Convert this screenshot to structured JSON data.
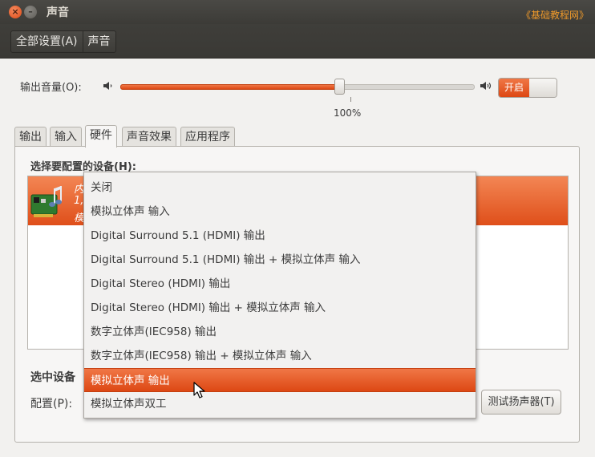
{
  "window": {
    "title": "声音",
    "close_icon": "×",
    "minimize_icon": "–",
    "watermark": "《基础教程网》"
  },
  "toolbar": {
    "all_settings": "全部设置(A)",
    "current": "声音"
  },
  "volume": {
    "label": "输出音量(O):",
    "value_percent": 62,
    "mark_label": "100%",
    "toggle_label": "开启",
    "toggle_on": true
  },
  "tabs": [
    {
      "label": "输出",
      "active": false
    },
    {
      "label": "输入",
      "active": false
    },
    {
      "label": "硬件",
      "active": true
    },
    {
      "label": "声音效果",
      "active": false
    },
    {
      "label": "应用程序",
      "active": false
    }
  ],
  "hardware": {
    "select_label": "选择要配置的设备(H):",
    "device_row_line1": "内",
    "device_row_line2": "1,",
    "device_row_line3": "模",
    "selected_device_label": "选中设备",
    "profile_label": "配置(P):",
    "test_button": "测试扬声器(T)"
  },
  "menu": {
    "items": [
      {
        "label": "关闭"
      },
      {
        "label": "模拟立体声 输入"
      },
      {
        "label": "Digital Surround 5.1 (HDMI) 输出"
      },
      {
        "label": "Digital Surround 5.1 (HDMI) 输出 + 模拟立体声 输入"
      },
      {
        "label": "Digital Stereo (HDMI) 输出"
      },
      {
        "label": "Digital Stereo (HDMI) 输出 + 模拟立体声 输入"
      },
      {
        "label": "数字立体声(IEC958) 输出"
      },
      {
        "label": "数字立体声(IEC958) 输出 + 模拟立体声 输入"
      },
      {
        "label": "模拟立体声 输出"
      },
      {
        "label": "模拟立体声双工"
      }
    ],
    "selected_index": 8
  },
  "colors": {
    "accent": "#dd4814",
    "titlebar": "#3c3b37"
  }
}
